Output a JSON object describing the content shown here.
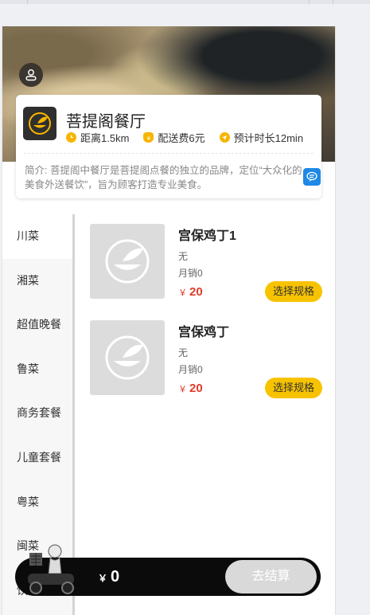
{
  "shop": {
    "name": "菩提阁餐厅",
    "distance": "距离1.5km",
    "delivery_fee": "配送费6元",
    "delivery_time": "预计时长12min",
    "intro": "简介: 菩提阁中餐厅是菩提阁点餐的独立的品牌，定位“大众化的美食外送餐饮”，旨为顾客打造专业美食。"
  },
  "categories": [
    {
      "label": "川菜",
      "active": true
    },
    {
      "label": "湘菜",
      "active": false
    },
    {
      "label": "超值晚餐",
      "active": false
    },
    {
      "label": "鲁菜",
      "active": false
    },
    {
      "label": "商务套餐",
      "active": false
    },
    {
      "label": "儿童套餐",
      "active": false
    },
    {
      "label": "粤菜",
      "active": false
    },
    {
      "label": "闽菜",
      "active": false
    },
    {
      "label": "饮品",
      "active": false
    }
  ],
  "foods": [
    {
      "name": "宫保鸡丁1",
      "desc": "无",
      "sales": "月销0",
      "currency": "￥",
      "price": "20",
      "spec_label": "选择规格"
    },
    {
      "name": "宫保鸡丁",
      "desc": "无",
      "sales": "月销0",
      "currency": "￥",
      "price": "20",
      "spec_label": "选择规格"
    }
  ],
  "cart": {
    "currency": "￥",
    "total": "0",
    "checkout_label": "去结算"
  },
  "colors": {
    "accent": "#f7c300",
    "price": "#e03b2a",
    "cart_bar": "#0b0b0b",
    "checkout_disabled": "#d9d9d9"
  },
  "icons": {
    "avatar": "user-icon",
    "logo": "leaf-bowl-logo",
    "distance": "clock-icon",
    "fee": "money-bag-icon",
    "time": "navigation-icon",
    "message": "chat-icon",
    "rider": "delivery-rider-icon"
  }
}
